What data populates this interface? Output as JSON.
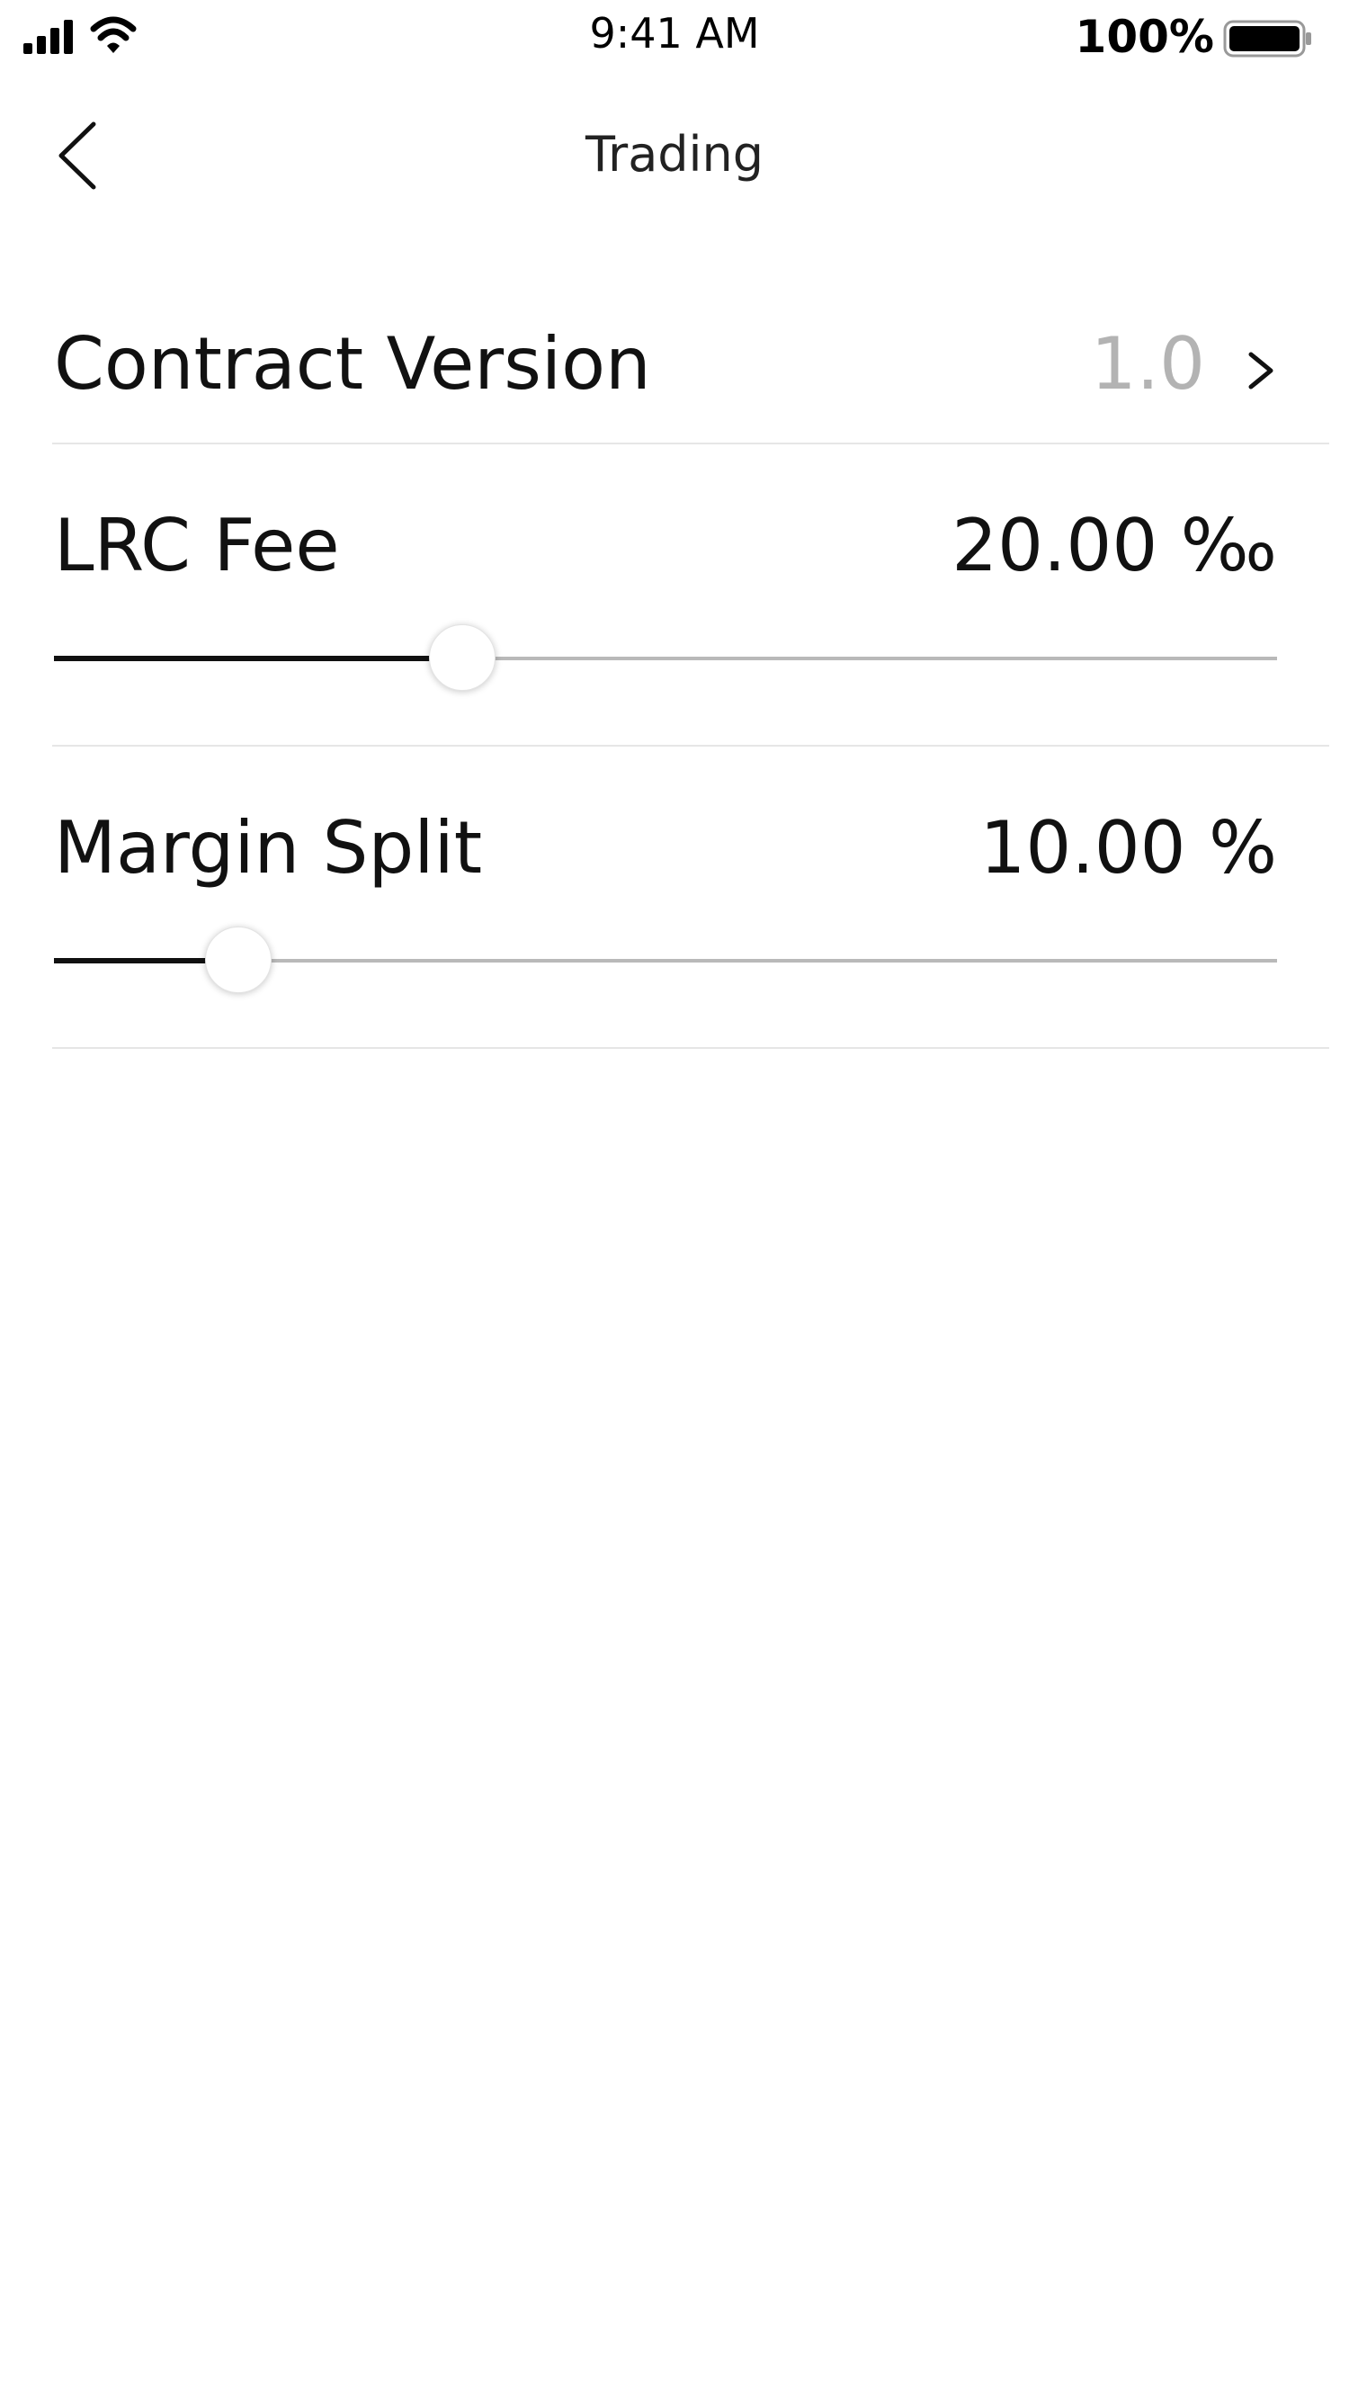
{
  "status_bar": {
    "time": "9:41 AM",
    "battery": "100%",
    "icons": [
      "signal-icon",
      "wifi-icon",
      "battery-icon"
    ]
  },
  "nav": {
    "title": "Trading",
    "back_icon": "chevron-left-icon"
  },
  "settings": {
    "contract_version": {
      "label": "Contract Version",
      "value": "1.0",
      "icon": "chevron-right-icon"
    },
    "lrc_fee": {
      "label": "LRC Fee",
      "value": "20.00 ‰",
      "slider_fraction": 0.334
    },
    "margin_split": {
      "label": "Margin Split",
      "value": "10.00 %",
      "slider_fraction": 0.151
    }
  },
  "colors": {
    "text": "#111111",
    "muted_value": "#b3b3b3",
    "divider": "#e6e6e6",
    "track": "#b9b9b9",
    "track_fill": "#111111"
  }
}
